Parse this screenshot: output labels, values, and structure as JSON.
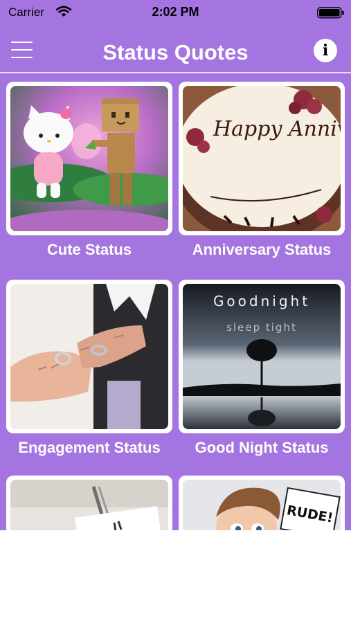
{
  "status_bar": {
    "carrier": "Carrier",
    "time": "2:02 PM"
  },
  "navbar": {
    "title": "Status Quotes",
    "menu_icon": "hamburger-icon",
    "info_icon": "info-icon",
    "info_glyph": "i"
  },
  "colors": {
    "background": "#a474e0",
    "card": "#ffffff",
    "text": "#ffffff"
  },
  "categories": [
    {
      "label": "Cute Status"
    },
    {
      "label": "Anniversary Status",
      "image_text": "Happy Anniversary"
    },
    {
      "label": "Engagement Status"
    },
    {
      "label": "Good Night Status",
      "image_title": "Goodnight",
      "image_subtitle": "sleep tight"
    },
    {
      "label": ""
    },
    {
      "label": "",
      "image_text": "RUDE!"
    }
  ]
}
